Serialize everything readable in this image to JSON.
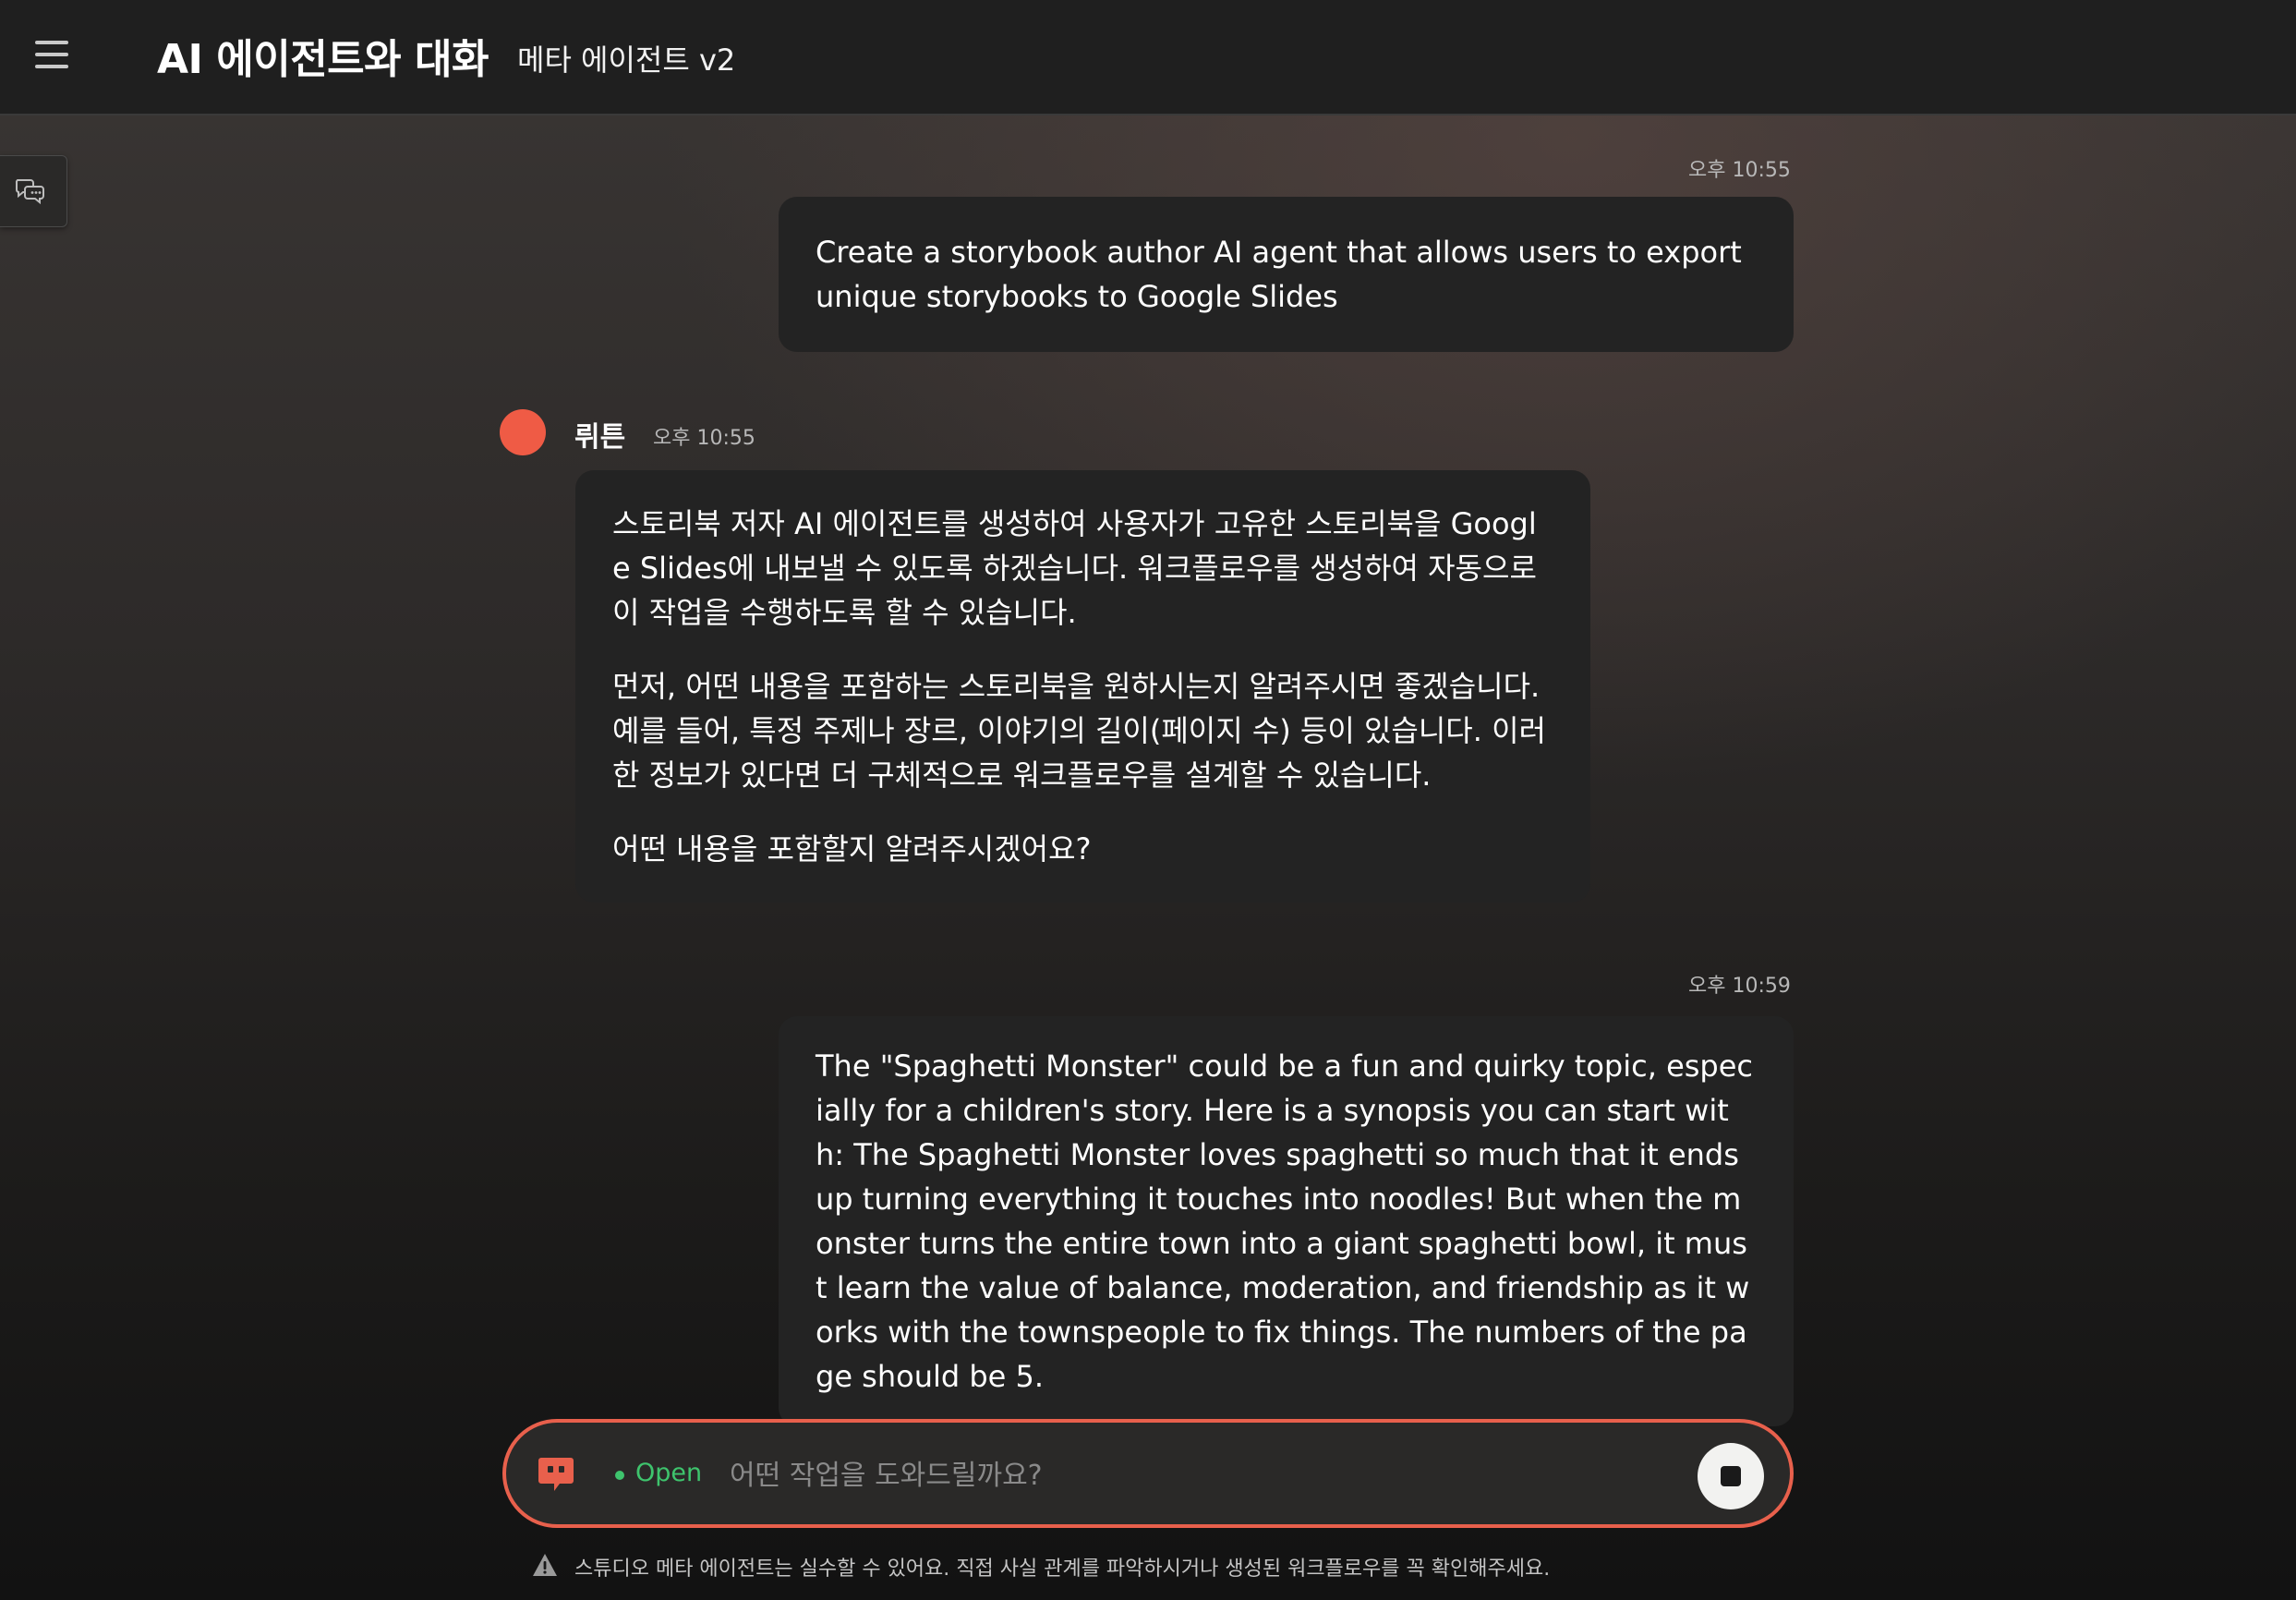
{
  "header": {
    "menu_icon": "hamburger-menu-icon",
    "title": "AI 에이전트와 대화",
    "subtitle": "메타 에이전트 v2"
  },
  "side_tab": {
    "icon": "chat-bubbles-icon"
  },
  "messages": [
    {
      "role": "user",
      "time": "오후 10:55",
      "paragraphs": [
        "Create a storybook author AI agent that allows users to export unique storybooks to Google Slides"
      ]
    },
    {
      "role": "agent",
      "name": "뤼튼",
      "time": "오후 10:55",
      "avatar_color": "#ef5b45",
      "paragraphs": [
        "스토리북 저자 AI 에이전트를 생성하여 사용자가 고유한 스토리북을 Google Slides에 내보낼 수 있도록 하겠습니다. 워크플로우를 생성하여 자동으로 이 작업을 수행하도록 할 수 있습니다.",
        "먼저, 어떤 내용을 포함하는 스토리북을 원하시는지 알려주시면 좋겠습니다. 예를 들어, 특정 주제나 장르, 이야기의 길이(페이지 수) 등이 있습니다. 이러한 정보가 있다면 더 구체적으로 워크플로우를 설계할 수 있습니다.",
        "어떤 내용을 포함할지 알려주시겠어요?"
      ]
    },
    {
      "role": "user",
      "time": "오후 10:59",
      "paragraphs": [
        "The \"Spaghetti Monster\" could be a fun and quirky topic, especially for a children's story. Here is a synopsis you can start with: The Spaghetti Monster loves spaghetti so much that it ends up turning everything it touches into noodles! But when the monster turns the entire town into a giant spaghetti bowl, it must learn the value of balance, moderation, and friendship as it works with the townspeople to fix things. The numbers of the page should be 5."
      ]
    }
  ],
  "input": {
    "chat_icon": "chat-bubble-icon",
    "status_label": "Open",
    "status_color": "#3ec46d",
    "placeholder": "어떤 작업을 도와드릴까요?",
    "value": "",
    "stop_icon": "stop-icon",
    "accent_color": "#e8604c"
  },
  "disclaimer": {
    "icon": "warning-icon",
    "text": "스튜디오 메타 에이전트는 실수할 수 있어요. 직접 사실 관계를 파악하시거나 생성된 워크플로우를 꼭 확인해주세요."
  }
}
